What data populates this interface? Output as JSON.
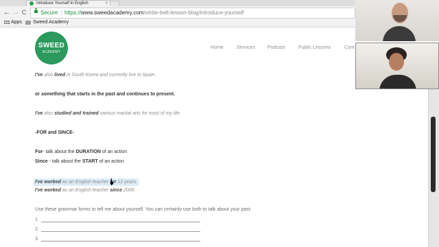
{
  "browser": {
    "tab_title": "Introduce Yourself in English",
    "tab_close": "×",
    "nav": {
      "back": "←",
      "forward": "→",
      "reload": "C"
    },
    "secure_label": "Secure",
    "url_scheme": "https://",
    "url_host": "www.sweedacademy.com",
    "url_path": "/white-belt-lesson-blog/introduce-yourself",
    "bookmarks": [
      {
        "label": "Apps",
        "icon": "apps-grid-icon"
      },
      {
        "label": "Sweed Academy",
        "icon": "folder-icon"
      }
    ]
  },
  "site": {
    "logo_word": "SWEED",
    "logo_sub": "ACADEMY",
    "brand_color": "#2b9a5c",
    "nav": [
      "Home",
      "Services",
      "Podcast",
      "Public Lessons",
      "Cont"
    ]
  },
  "content": {
    "l1": {
      "a": "I've",
      "b": " also ",
      "c": "lived",
      "d": " in South Korea and currently live in Spain."
    },
    "l2": "or something that starts in the past and continues to present.",
    "l3": {
      "a": "I've",
      "b": " also ",
      "c": "studied and trained",
      "d": " various martial arts for most of my life."
    },
    "l4": "-FOR and SINCE-",
    "l5": {
      "a": "For",
      "b": "- talk about the ",
      "c": "DURATION",
      "d": " of an action"
    },
    "l6": {
      "a": "Since",
      "b": " - talk about the ",
      "c": "START",
      "d": " of an action"
    },
    "l7": {
      "a": "I've worked",
      "b": " as an English teacher ",
      "c": "for",
      "d": " 12 years."
    },
    "l8": {
      "a": "I've worked",
      "b": " as an English teacher ",
      "c": "since",
      "d": " 2006."
    },
    "prompt": "Use these grammar forms to tell me about yourself. You can certainly use both to talk about your past.",
    "blanks": [
      "1.",
      "2.",
      "3."
    ],
    "highlight_color": "#dcedf8"
  }
}
